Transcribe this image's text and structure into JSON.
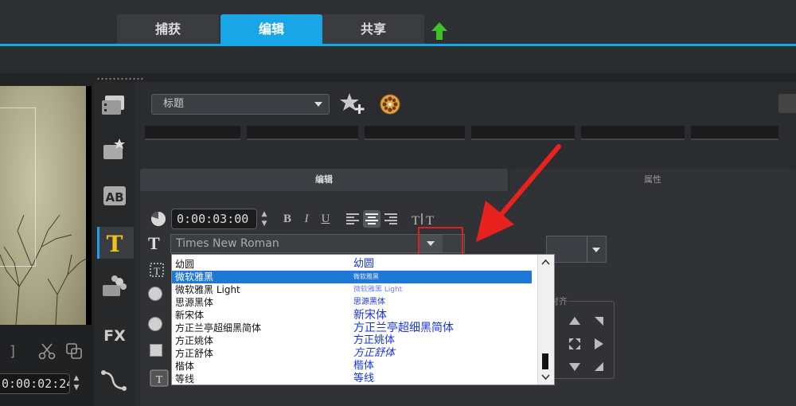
{
  "top_tabs": [
    {
      "label": "捕获",
      "active": false
    },
    {
      "label": "编辑",
      "active": true
    },
    {
      "label": "共享",
      "active": false
    }
  ],
  "preview": {
    "timecode": "0:00:02:24"
  },
  "library": {
    "category_selected": "标题"
  },
  "edit_panel": {
    "tabs": [
      {
        "label": "编辑",
        "active": true
      },
      {
        "label": "属性",
        "active": false
      }
    ],
    "duration": "0:00:03:00",
    "format_buttons": [
      "B",
      "I",
      "U"
    ],
    "font_family": "Times New Roman",
    "alignment_label": "对齐"
  },
  "font_list": {
    "items": [
      {
        "name": "幼圆",
        "preview": "幼圆",
        "selected": false
      },
      {
        "name": "微软雅黑",
        "preview": "微软雅黑",
        "selected": true
      },
      {
        "name": "微软雅黑 Light",
        "preview": "微软雅黑 Light",
        "selected": false
      },
      {
        "name": "思源黑体",
        "preview": "思源黑体",
        "selected": false
      },
      {
        "name": "新宋体",
        "preview": "新宋体",
        "selected": false
      },
      {
        "name": "方正兰亭超细黑简体",
        "preview": "方正兰亭超细黑简体",
        "selected": false
      },
      {
        "name": "方正姚体",
        "preview": "方正姚体",
        "selected": false
      },
      {
        "name": "方正舒体",
        "preview": "方正舒体",
        "selected": false
      },
      {
        "name": "楷体",
        "preview": "楷体",
        "selected": false
      },
      {
        "name": "等线",
        "preview": "等线",
        "selected": false
      }
    ]
  },
  "colors": {
    "accent": "#19a6e6",
    "highlight": "#e02020",
    "list_selection": "#1d78d6",
    "preview_text": "#1734d8"
  },
  "icons": {
    "upload": "upload-arrow-icon",
    "add_favorite": "star-add-icon",
    "film_reel": "film-reel-icon",
    "duration": "clock-icon",
    "font": "text-t-icon"
  }
}
